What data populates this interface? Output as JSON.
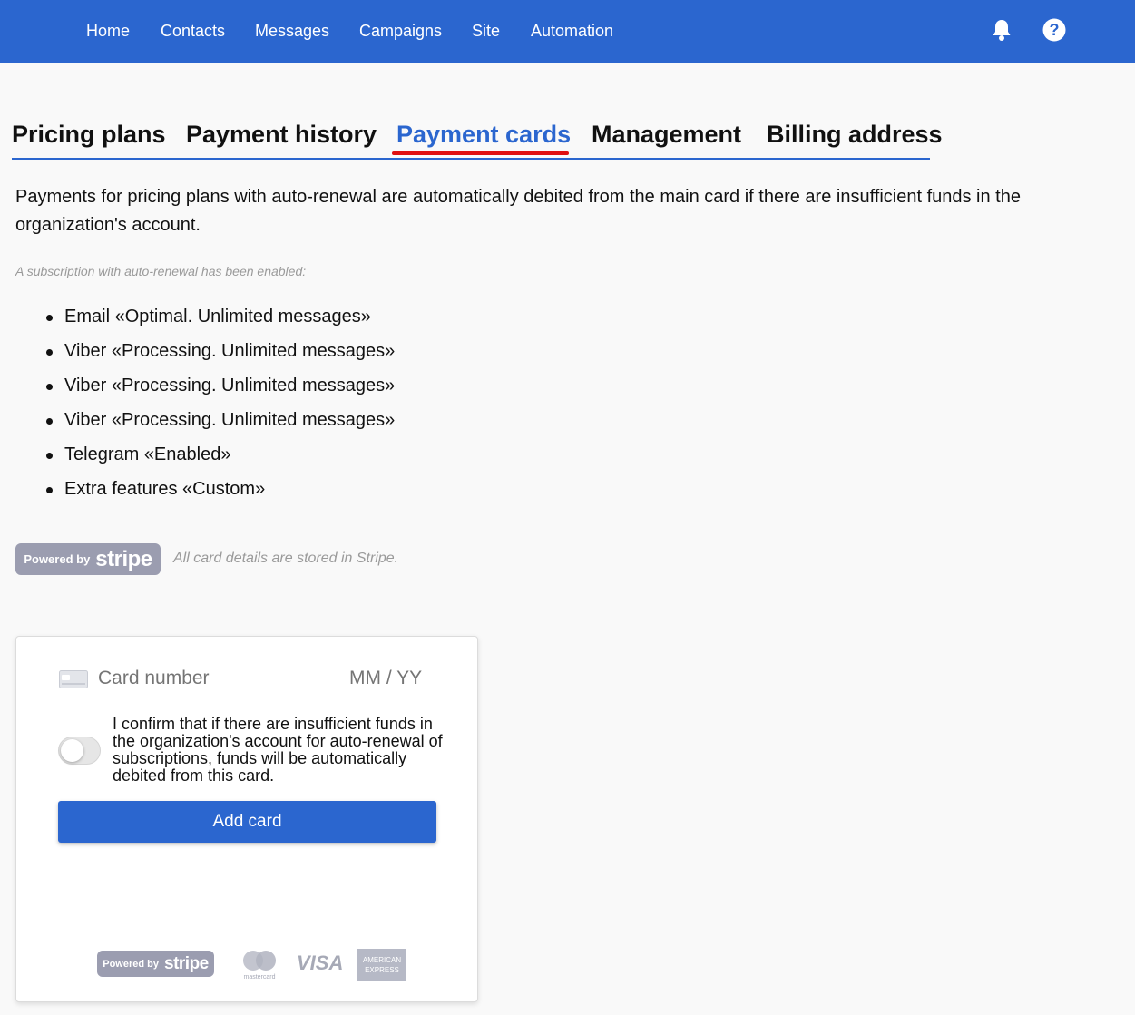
{
  "colors": {
    "brand": "#2b66cf",
    "tab_active_underline": "#e01010",
    "muted_text": "#9a9a9a",
    "stripe_badge": "#9b9db0"
  },
  "nav": {
    "items": [
      {
        "label": "Home"
      },
      {
        "label": "Contacts"
      },
      {
        "label": "Messages"
      },
      {
        "label": "Campaigns"
      },
      {
        "label": "Site"
      },
      {
        "label": "Automation"
      }
    ],
    "icons": [
      "bell-icon",
      "help-icon"
    ]
  },
  "tabs": {
    "items": [
      {
        "label": "Pricing plans"
      },
      {
        "label": "Payment history"
      },
      {
        "label": "Payment cards"
      },
      {
        "label": "Management"
      },
      {
        "label": "Billing address"
      }
    ],
    "active": "Payment cards"
  },
  "intro_text": "Payments for pricing plans with auto-renewal are automatically debited from the main card if there are insufficient funds in the organization's account.",
  "subscriptions": {
    "caption": "A subscription with auto-renewal has been enabled:",
    "items": [
      "Email «Optimal. Unlimited messages»",
      "Viber «Processing. Unlimited messages»",
      "Viber «Processing. Unlimited messages»",
      "Viber «Processing. Unlimited messages»",
      "Telegram «Enabled»",
      "Extra features «Custom»"
    ]
  },
  "stripe": {
    "powered_by": "Powered by",
    "wordmark": "stripe",
    "note": "All card details are stored in Stripe."
  },
  "card_form": {
    "card_number_placeholder": "Card number",
    "expiry_placeholder": "MM / YY",
    "confirm_toggle_on": false,
    "confirm_text": "I confirm that if there are insufficient funds in the organization's account for auto-renewal of subscriptions, funds will be automatically debited from this card.",
    "add_button": "Add card",
    "logos": {
      "mastercard": "mastercard",
      "visa": "VISA",
      "amex_line1": "AMERICAN",
      "amex_line2": "EXPRESS"
    }
  }
}
